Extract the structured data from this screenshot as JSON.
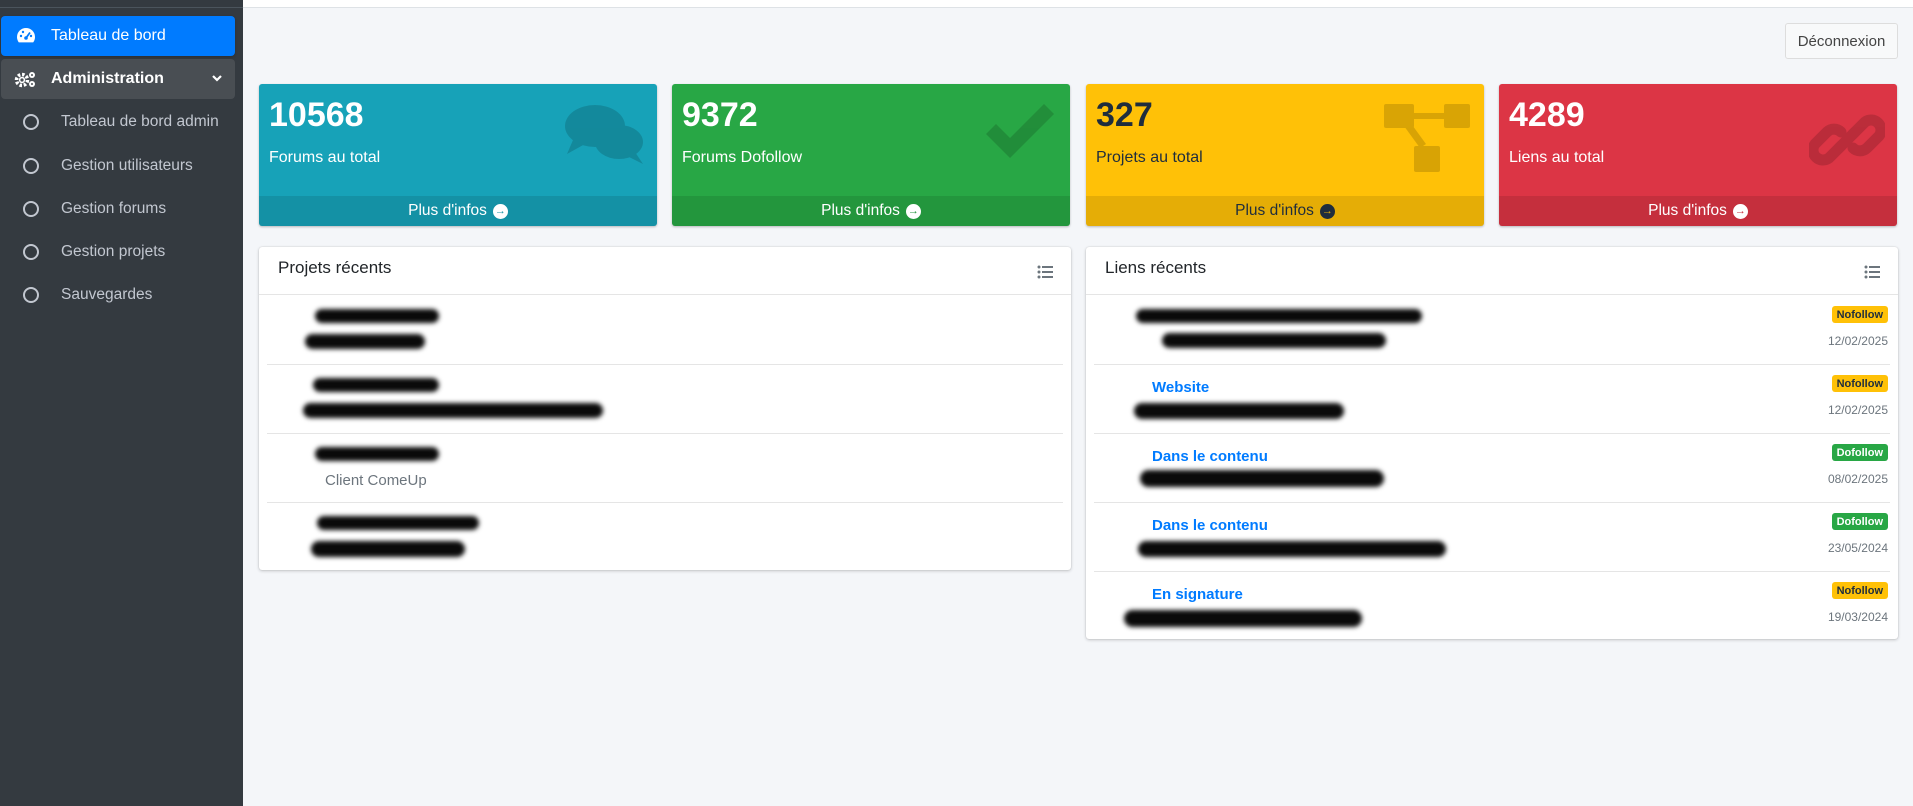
{
  "header": {
    "logout_label": "Déconnexion"
  },
  "sidebar": {
    "dashboard": {
      "label": "Tableau de bord",
      "icon": "tachometer-icon"
    },
    "admin": {
      "label": "Administration",
      "icon": "cogs-icon"
    },
    "sub_items": [
      {
        "label": "Tableau de bord admin"
      },
      {
        "label": "Gestion utilisateurs"
      },
      {
        "label": "Gestion forums"
      },
      {
        "label": "Gestion projets"
      },
      {
        "label": "Sauvegardes"
      }
    ]
  },
  "stats": [
    {
      "value": "10568",
      "label": "Forums au total",
      "more": "Plus d'infos",
      "color": "#17a2b8",
      "icon": "comments-icon"
    },
    {
      "value": "9372",
      "label": "Forums Dofollow",
      "more": "Plus d'infos",
      "color": "#28a745",
      "icon": "check-icon"
    },
    {
      "value": "327",
      "label": "Projets au total",
      "more": "Plus d'infos",
      "color": "#ffc107",
      "icon": "project-diagram-icon"
    },
    {
      "value": "4289",
      "label": "Liens au total",
      "more": "Plus d'infos",
      "color": "#dc3545",
      "icon": "link-icon"
    }
  ],
  "recent_projects": {
    "title": "Projets récents",
    "rows": [
      {
        "client": ""
      },
      {
        "client": ""
      },
      {
        "client": "Client ComeUp"
      },
      {
        "client": ""
      }
    ]
  },
  "recent_links": {
    "title": "Liens récents",
    "rows": [
      {
        "type": "",
        "badge": "Nofollow",
        "date": "12/02/2025"
      },
      {
        "type": "Website",
        "badge": "Nofollow",
        "date": "12/02/2025"
      },
      {
        "type": "Dans le contenu",
        "badge": "Dofollow",
        "date": "08/02/2025"
      },
      {
        "type": "Dans le contenu",
        "badge": "Dofollow",
        "date": "23/05/2024"
      },
      {
        "type": "En signature",
        "badge": "Nofollow",
        "date": "19/03/2024"
      }
    ]
  }
}
